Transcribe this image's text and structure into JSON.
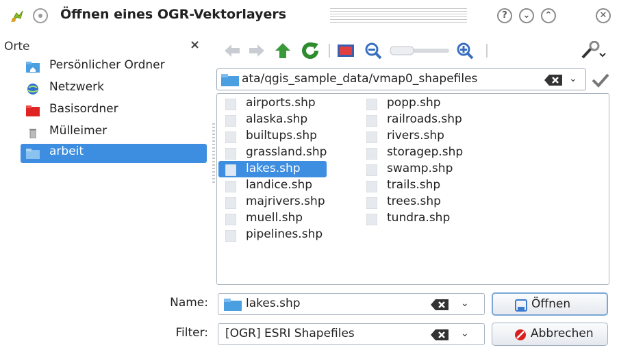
{
  "window": {
    "title": "Öffnen eines OGR-Vektorlayers",
    "controls": [
      "?",
      "⌄",
      "⌃",
      "✕"
    ]
  },
  "places": {
    "header": "Orte",
    "close": "×",
    "items": [
      {
        "label": "Persönlicher Ordner",
        "icon": "home-folder-icon"
      },
      {
        "label": "Netzwerk",
        "icon": "network-icon"
      },
      {
        "label": "Basisordner",
        "icon": "red-folder-icon"
      },
      {
        "label": "Mülleimer",
        "icon": "trash-icon"
      },
      {
        "label": "arbeit",
        "icon": "folder-icon",
        "selected": true
      }
    ]
  },
  "toolbar": {
    "tools": [
      "back-icon",
      "forward-icon",
      "up-icon",
      "reload-icon",
      "view-icon",
      "zoom-out-icon",
      "zoom-slider",
      "zoom-in-icon",
      "settings-icon"
    ]
  },
  "path": {
    "value": "ata/qgis_sample_data/vmap0_shapefiles"
  },
  "files": {
    "column1": [
      "airports.shp",
      "alaska.shp",
      "builtups.shp",
      "grassland.shp",
      "lakes.shp",
      "landice.shp",
      "majrivers.shp",
      "muell.shp",
      "pipelines.shp"
    ],
    "column2": [
      "popp.shp",
      "railroads.shp",
      "rivers.shp",
      "storagep.shp",
      "swamp.shp",
      "trails.shp",
      "trees.shp",
      "tundra.shp"
    ],
    "selected": "lakes.shp"
  },
  "name_row": {
    "label": "Name:",
    "value": "lakes.shp"
  },
  "filter_row": {
    "label": "Filter:",
    "value": "[OGR] ESRI Shapefiles"
  },
  "buttons": {
    "open": "Öffnen",
    "cancel": "Abbrechen"
  },
  "colors": {
    "selection": "#3d8ee0",
    "folder": "#4a9fe0"
  }
}
